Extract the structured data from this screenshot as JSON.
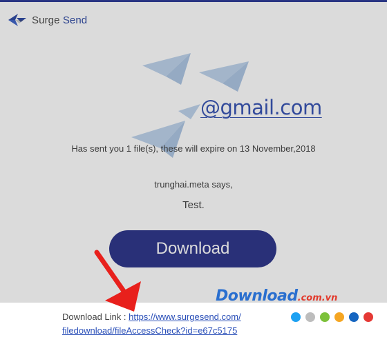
{
  "brand": {
    "surge": "Surge",
    "send": "Send",
    "primary_color": "#1c2480",
    "accent_color": "#2746ad"
  },
  "email": {
    "address": "@gmail.com",
    "sent_line": "Has sent you 1 file(s), these will expire on 13 November,2018",
    "sender_says": "trunghai.meta says,",
    "message": "Test.",
    "download_label": "Download"
  },
  "footer": {
    "link_label": "Download Link : ",
    "link_line1": "https://www.surgesend.com/",
    "link_line2": "filedownload/fileAccessCheck?id=e67c5175"
  },
  "watermark": {
    "main": "Download",
    "tld": ".com.vn",
    "dot_colors": [
      "#1da1f2",
      "#bdbdbd",
      "#7cc13a",
      "#f5a623",
      "#1565c0",
      "#e53935"
    ]
  },
  "annotation": {
    "arrow_color": "#e8201c"
  }
}
